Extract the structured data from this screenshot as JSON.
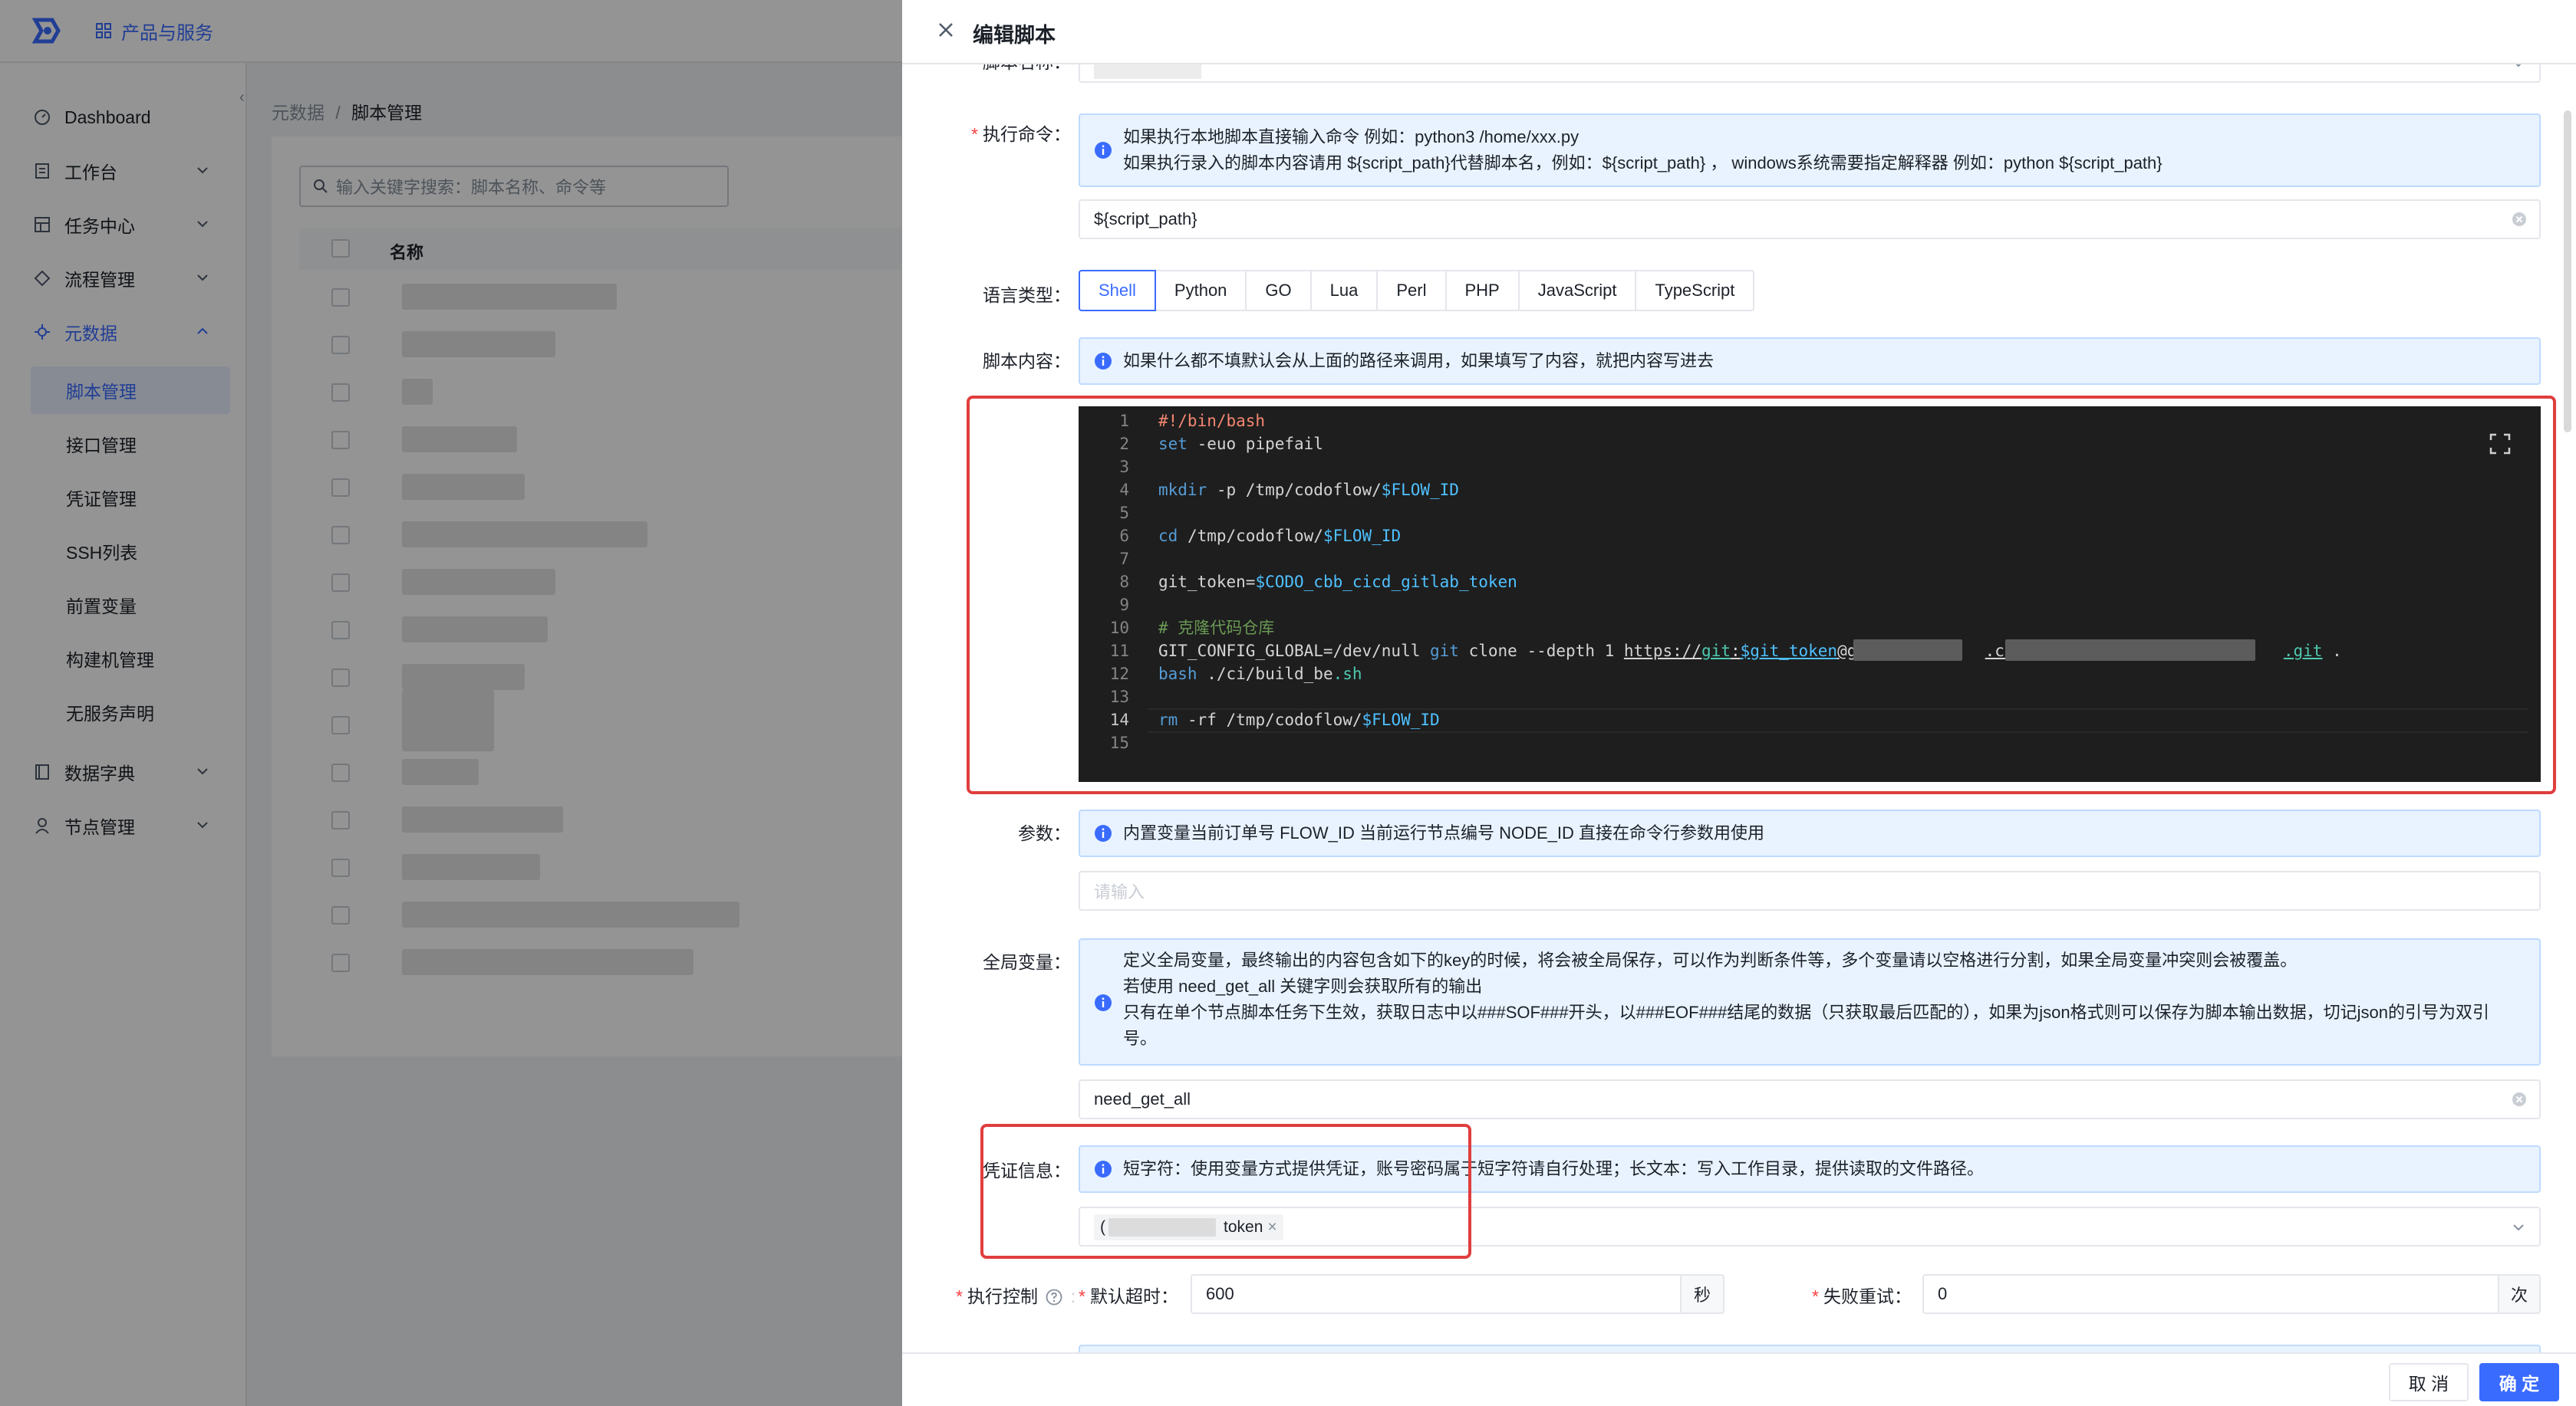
{
  "topbar": {
    "products_label": "产品与服务"
  },
  "sidebar": {
    "items": [
      {
        "label": "Dashboard",
        "icon": "dashboard-icon"
      },
      {
        "label": "工作台",
        "icon": "workbench-icon"
      },
      {
        "label": "任务中心",
        "icon": "task-icon"
      },
      {
        "label": "流程管理",
        "icon": "flow-icon"
      },
      {
        "label": "元数据",
        "icon": "metadata-icon"
      },
      {
        "label": "数据字典",
        "icon": "dictionary-icon"
      },
      {
        "label": "节点管理",
        "icon": "node-icon"
      }
    ],
    "subitems": [
      "脚本管理",
      "接口管理",
      "凭证管理",
      "SSH列表",
      "前置变量",
      "构建机管理",
      "无服务声明"
    ]
  },
  "breadcrumb": {
    "parent": "元数据",
    "separator": "/",
    "current": "脚本管理"
  },
  "list": {
    "search_placeholder": "输入关键字搜索：脚本名称、命令等",
    "col_name": "名称"
  },
  "drawer": {
    "title": "编辑脚本",
    "script_name_label": "脚本名称：",
    "exec_cmd": {
      "label": "执行命令：",
      "tip_line1": "如果执行本地脚本直接输入命令 例如：python3 /home/xxx.py",
      "tip_line2": "如果执行录入的脚本内容请用 ${script_path}代替脚本名，例如：${script_path} ， windows系统需要指定解释器 例如：python ${script_path}",
      "value": "${script_path}"
    },
    "lang": {
      "label": "语言类型：",
      "options": [
        "Shell",
        "Python",
        "GO",
        "Lua",
        "Perl",
        "PHP",
        "JavaScript",
        "TypeScript"
      ],
      "selected": "Shell"
    },
    "content": {
      "label": "脚本内容：",
      "tip": "如果什么都不填默认会从上面的路径来调用，如果填写了内容，就把内容写进去",
      "line_numbers": [
        "1",
        "2",
        "3",
        "4",
        "5",
        "6",
        "7",
        "8",
        "9",
        "10",
        "11",
        "12",
        "13",
        "14",
        "15"
      ],
      "code": {
        "l1": "#!/bin/bash",
        "l2_a": "set",
        "l2_b": " -euo pipefail",
        "l4_a": "mkdir",
        "l4_b": " -p /tmp/codoflow/",
        "l4_c": "$FLOW_ID",
        "l6_a": "cd",
        "l6_b": " /tmp/codoflow/",
        "l6_c": "$FLOW_ID",
        "l8_a": "git_token=",
        "l8_b": "$CODO_cbb_cicd_gitlab_token",
        "l10": "# 克隆代码仓库",
        "l11_a": "GIT_CONFIG_GLOBAL=/dev/null ",
        "l11_b": "git",
        "l11_c": " clone --depth 1 ",
        "l11_d": "https://",
        "l11_e": "git",
        "l11_f": ":",
        "l11_g": "$git_token",
        "l11_h": "@git",
        "l11_i": ".com/",
        "l11_j": ".git",
        "l11_k": " .",
        "l12_a": "bash",
        "l12_b": " ./ci/build_be",
        "l12_c": ".sh",
        "l14_a": "rm",
        "l14_b": " -rf /tmp/codoflow/",
        "l14_c": "$FLOW_ID"
      }
    },
    "params": {
      "label": "参数：",
      "tip": "内置变量当前订单号 FLOW_ID 当前运行节点编号 NODE_ID 直接在命令行参数用使用",
      "placeholder": "请输入"
    },
    "globals": {
      "label": "全局变量：",
      "tip_line1": "定义全局变量，最终输出的内容包含如下的key的时候，将会被全局保存，可以作为判断条件等，多个变量请以空格进行分割，如果全局变量冲突则会被覆盖。",
      "tip_line2": "若使用 need_get_all 关键字则会获取所有的输出",
      "tip_line3": "只有在单个节点脚本任务下生效，获取日志中以###SOF###开头，以###EOF###结尾的数据（只获取最后匹配的），如果为json格式则可以保存为脚本输出数据，切记json的引号为双引",
      "tip_line4": "号。",
      "value": "need_get_all"
    },
    "credential": {
      "label": "凭证信息：",
      "tip": "短字符：使用变量方式提供凭证，账号密码属于短字符请自行处理；长文本：写入工作目录，提供读取的文件路径。",
      "tag_prefix": "(",
      "tag_label": "token",
      "tag_close": "×"
    },
    "exec_control": {
      "label": "执行控制",
      "timeout_label": "默认超时：",
      "timeout_value": "600",
      "timeout_unit": "秒",
      "retry_label": "失败重试：",
      "retry_value": "0",
      "retry_unit": "次"
    },
    "footer": {
      "cancel": "取 消",
      "ok": "确 定"
    }
  },
  "colors": {
    "accent": "#3a6bff",
    "annotation": "#e03e3e",
    "editor_bg": "#1e1e1e"
  }
}
